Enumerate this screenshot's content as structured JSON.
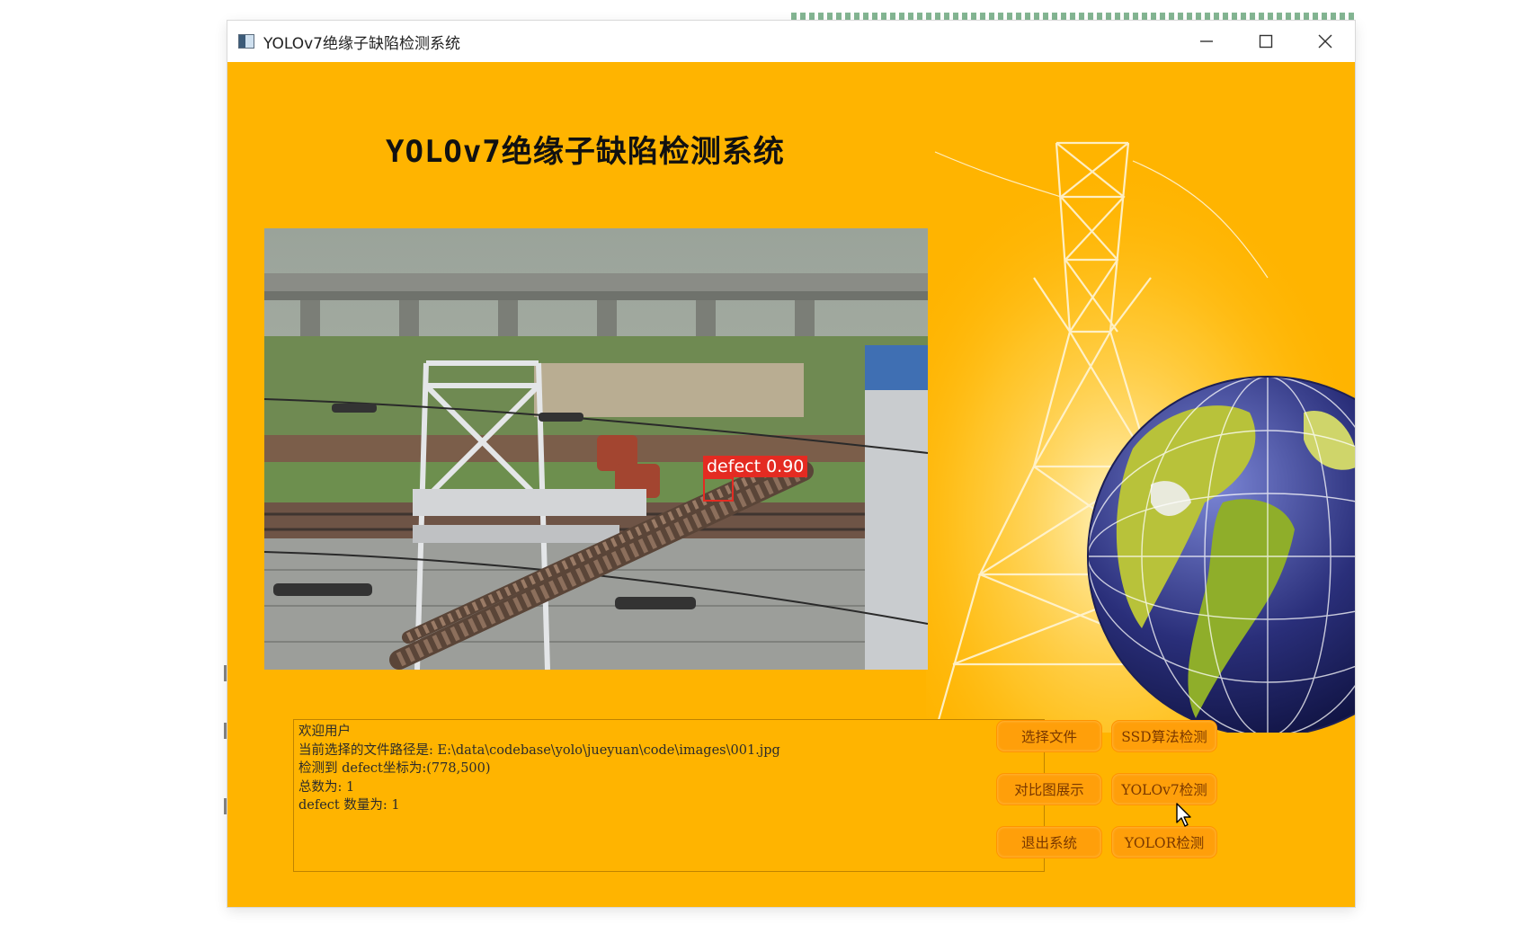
{
  "window": {
    "title": "YOLOv7绝缘子缺陷检测系统",
    "controls": [
      "minimize",
      "maximize",
      "close"
    ]
  },
  "app": {
    "heading": "YOLOv7绝缘子缺陷检测系统",
    "background_color": "#ffb400"
  },
  "detection": {
    "label": "defect 0.90",
    "class": "defect",
    "confidence": 0.9,
    "box_color": "#e42b22"
  },
  "log": {
    "lines": [
      "欢迎用户",
      "当前选择的文件路径是: E:\\data\\codebase\\yolo\\jueyuan\\code\\images\\001.jpg",
      "检测到 defect坐标为:(778,500)",
      "总数为: 1",
      "defect 数量为: 1"
    ]
  },
  "buttons": {
    "select_file": "选择文件",
    "ssd_detect": "SSD算法检测",
    "compare_view": "对比图展示",
    "yolov7_detect": "YOLOv7检测",
    "exit_system": "退出系统",
    "yolor_detect": "YOLOR检测"
  },
  "icons": {
    "app": "app-window-icon",
    "minimize": "minimize-icon",
    "maximize": "maximize-icon",
    "close": "close-icon",
    "pointer": "mouse-pointer-icon"
  }
}
